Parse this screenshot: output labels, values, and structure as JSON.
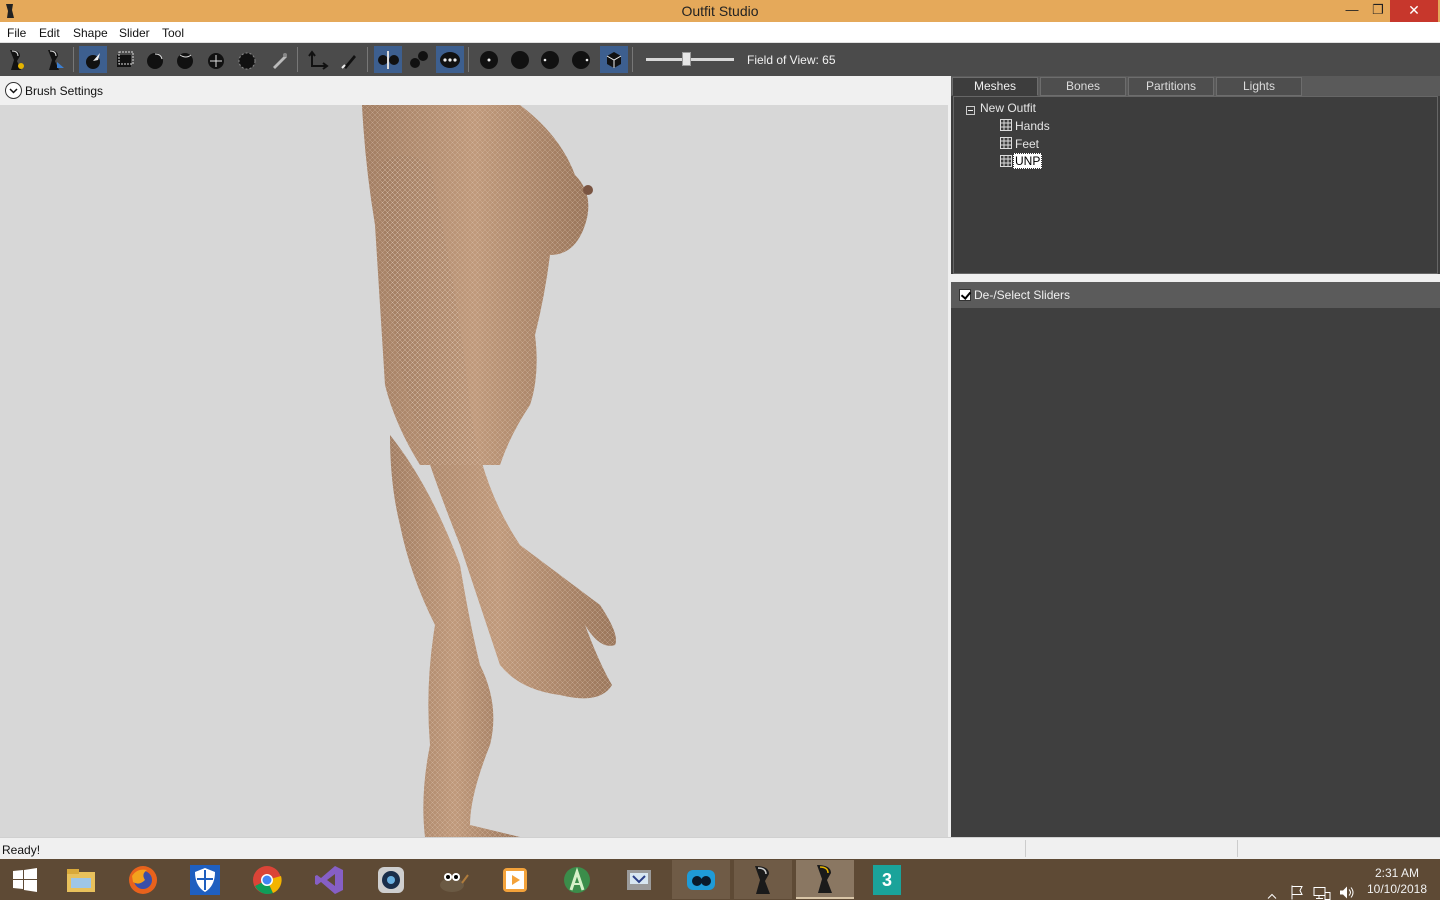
{
  "window": {
    "title": "Outfit Studio",
    "minimize_glyph": "—",
    "maximize_glyph": "❐",
    "close_glyph": "✕"
  },
  "menu": {
    "items": [
      "File",
      "Edit",
      "Shape",
      "Slider",
      "Tool"
    ]
  },
  "toolbar": {
    "fov_label": "Field of View: 65",
    "fov_value": 65,
    "tools": [
      "new-project-icon",
      "load-project-icon",
      "select-brush-icon",
      "mask-brush-icon",
      "inflate-brush-icon",
      "deflate-brush-icon",
      "move-brush-icon",
      "smooth-brush-icon",
      "weight-paint-icon",
      "transform-icon",
      "color-brush-icon",
      "x-mirror-icon",
      "connected-only-icon",
      "global-brush-icon",
      "show-points-icon",
      "show-wireframe-icon",
      "show-lighting-icon",
      "show-masks-icon",
      "show-textures-icon"
    ],
    "accent_color": "#3d5f8f"
  },
  "brush_settings": {
    "label": "Brush Settings"
  },
  "panel": {
    "tabs": [
      "Meshes",
      "Bones",
      "Partitions",
      "Lights"
    ],
    "active_tab": "Meshes",
    "tree": {
      "root": "New Outfit",
      "meshes": [
        "Hands",
        "Feet",
        "UNP"
      ],
      "selected": "UNP"
    },
    "sliders_header": "De-/Select Sliders"
  },
  "status": {
    "text": "Ready!"
  },
  "taskbar": {
    "apps": [
      "windows-start-icon",
      "file-explorer-icon",
      "firefox-icon",
      "windows-defender-icon",
      "chrome-icon",
      "visual-studio-icon",
      "camera-app-icon",
      "gimp-icon",
      "media-player-icon",
      "android-studio-icon",
      "vm-manager-icon",
      "cloud-app-icon",
      "outfit-studio-icon",
      "outfit-studio-active-icon",
      "3ds-max-icon"
    ],
    "time": "2:31 AM",
    "date": "10/10/2018"
  }
}
